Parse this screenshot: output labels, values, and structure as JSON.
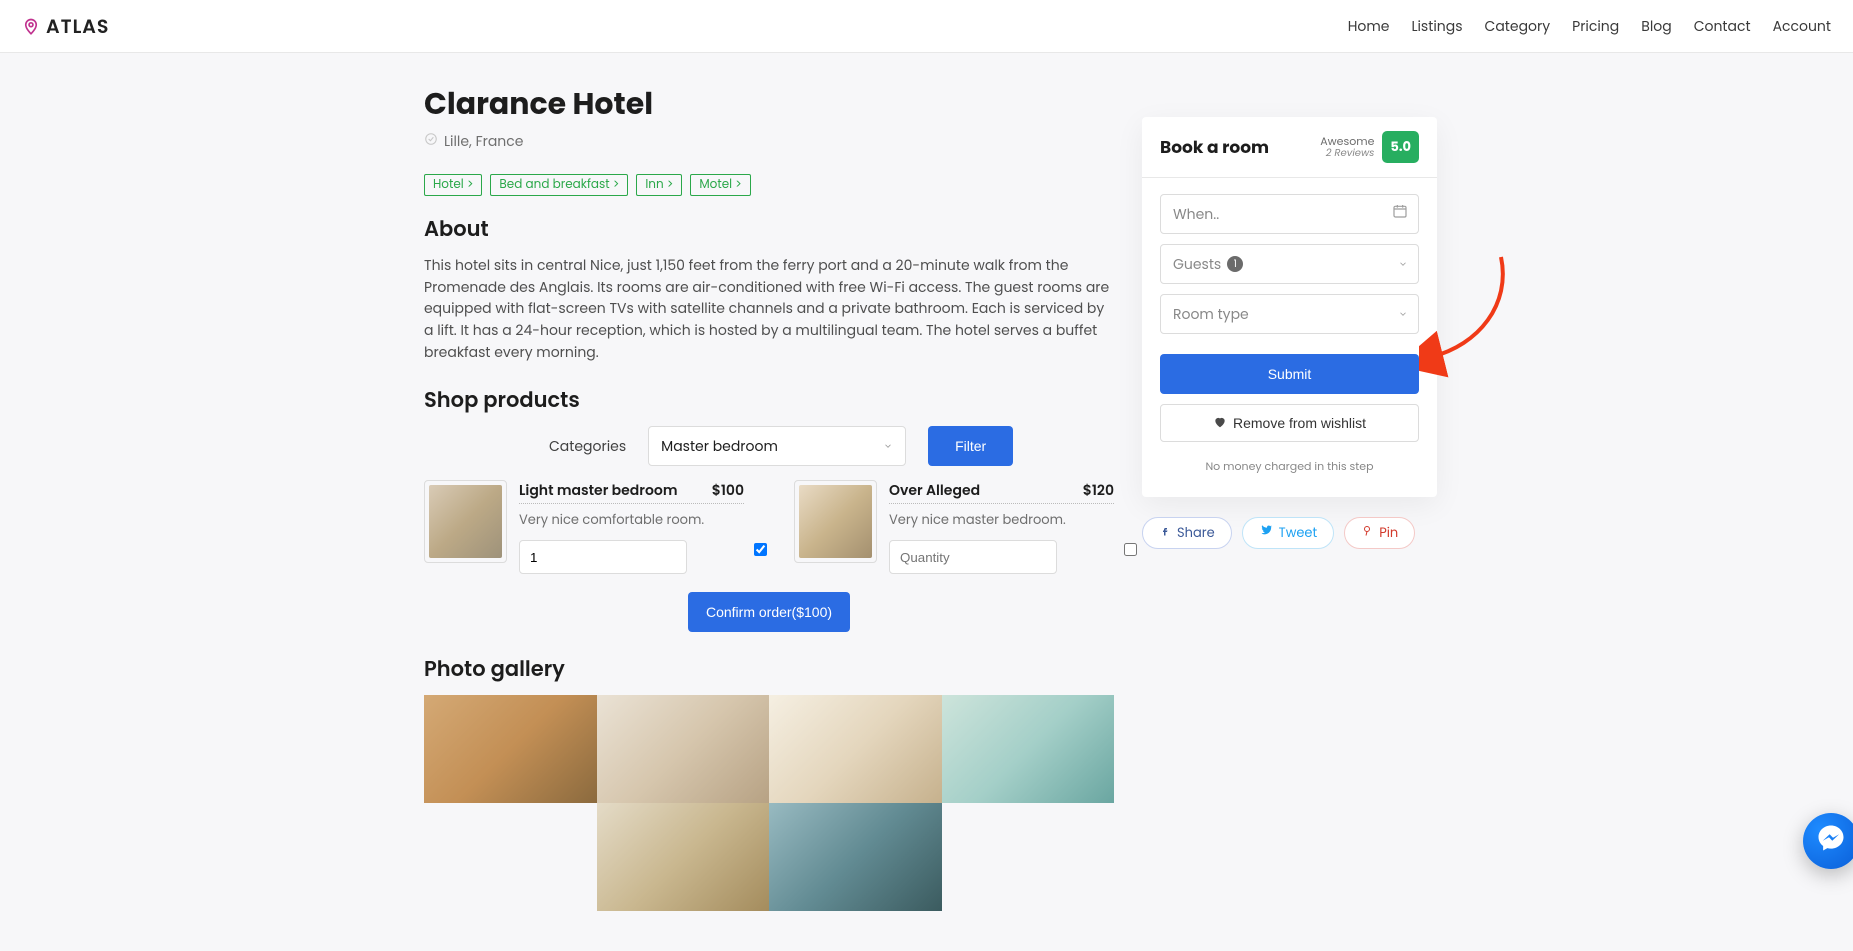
{
  "brand": "ATLAS",
  "nav": [
    "Home",
    "Listings",
    "Category",
    "Pricing",
    "Blog",
    "Contact",
    "Account"
  ],
  "listing": {
    "title": "Clarance Hotel",
    "location": "Lille, France",
    "tags": [
      "Hotel >",
      "Bed and breakfast >",
      "Inn >",
      "Motel >"
    ],
    "about_heading": "About",
    "about_text": "This hotel sits in central Nice, just 1,150 feet from the ferry port and a 20-minute walk from the Promenade des Anglais. Its rooms are air-conditioned with free Wi-Fi access. The guest rooms are equipped with flat-screen TVs with satellite channels and a private bathroom. Each is serviced by a lift. It has a 24-hour reception, which is hosted by a multilingual team. The hotel serves a buffet breakfast every morning."
  },
  "shop": {
    "heading": "Shop products",
    "categories_label": "Categories",
    "categories_selected": "Master bedroom",
    "filter_label": "Filter",
    "products": [
      {
        "name": "Light master bedroom",
        "price": "$100",
        "desc": "Very nice comfortable room.",
        "qty": "1",
        "qty_placeholder": "Quantity",
        "checked": true
      },
      {
        "name": "Over Alleged",
        "price": "$120",
        "desc": "Very nice master bedroom.",
        "qty": "",
        "qty_placeholder": "Quantity",
        "checked": false
      }
    ],
    "confirm_label": "Confirm order($100)"
  },
  "gallery_heading": "Photo gallery",
  "booking": {
    "title": "Book a room",
    "rating_word": "Awesome",
    "reviews_text": "2 Reviews",
    "rating": "5.0",
    "when_placeholder": "When..",
    "guests_label": "Guests",
    "guests_count": "1",
    "roomtype_label": "Room type",
    "submit_label": "Submit",
    "wishlist_label": "Remove from wishlist",
    "note": "No money charged in this step"
  },
  "share": {
    "share": "Share",
    "tweet": "Tweet",
    "pin": "Pin"
  }
}
